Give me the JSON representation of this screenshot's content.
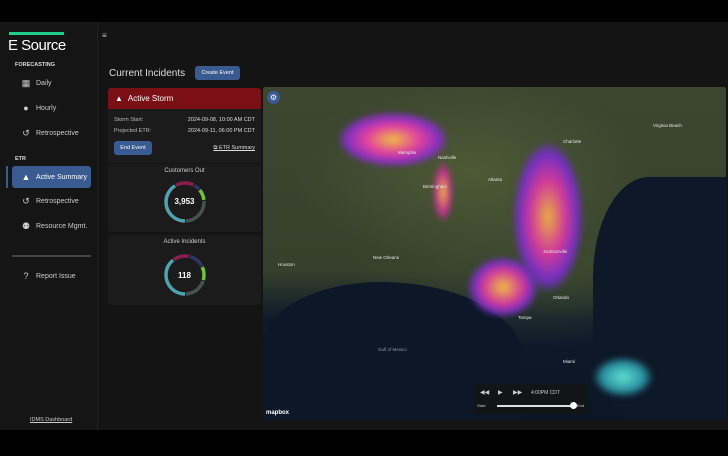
{
  "sidebar": {
    "logo": "E Source",
    "sections": [
      {
        "label": "FORECASTING"
      },
      {
        "label": "ETR"
      }
    ],
    "items": [
      {
        "label": "Daily",
        "icon": "calendar-icon"
      },
      {
        "label": "Hourly",
        "icon": "user-clock-icon"
      },
      {
        "label": "Retrospective",
        "icon": "history-icon"
      },
      {
        "label": "Active Summary",
        "icon": "warning-icon"
      },
      {
        "label": "Retrospective",
        "icon": "history-icon"
      },
      {
        "label": "Resource Mgmt.",
        "icon": "users-icon"
      },
      {
        "label": "Report Issue",
        "icon": "question-icon"
      }
    ],
    "footer_link": "IDMS Dashboard"
  },
  "header": {
    "title": "Current Incidents",
    "create_event": "Create Event"
  },
  "storm": {
    "title": "Active Storm",
    "start_label": "Storm Start:",
    "start_value": "2024-09-08, 10:00 AM CDT",
    "etr_label": "Projected ETR:",
    "etr_value": "2024-09-11, 06:00 PM CDT",
    "end_event": "End Event",
    "etr_summary": "ETR Summary"
  },
  "customers_out": {
    "title": "Customers Out",
    "value": "3,953"
  },
  "active_incidents": {
    "title": "Active Incidents",
    "value": "118"
  },
  "colors": {
    "accent": "#3a5a92",
    "alert": "#7a1016",
    "brand": "#1fd18a",
    "donut": [
      "#4fa3b0",
      "#8a1f4a",
      "#2f3566",
      "#6fc23a",
      "#4a5050"
    ]
  },
  "map": {
    "attribution": "mapbox",
    "cities": [
      "Memphis",
      "Birmingham",
      "Atlanta",
      "Charlotte",
      "Jacksonville",
      "Tampa",
      "Miami",
      "New Orleans",
      "Houston",
      "Gulf of Mexico",
      "Virginia Beach",
      "Nashville",
      "Orlando"
    ],
    "player": {
      "time": "4:00PM CDT",
      "start": "Start",
      "end": "End",
      "progress": 1.0
    }
  }
}
